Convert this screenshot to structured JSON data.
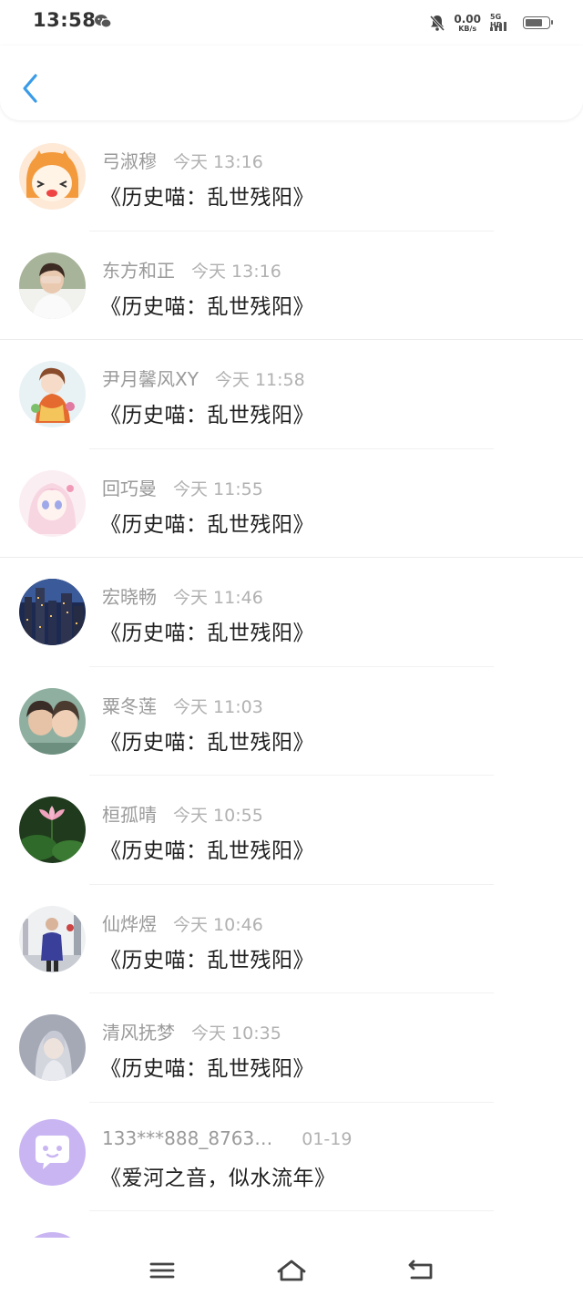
{
  "status_bar": {
    "time": "13:58",
    "net_speed_value": "0.00",
    "net_speed_unit": "KB/s",
    "signal_label": "5G HD",
    "battery_level_percent": 80
  },
  "header": {
    "back_icon": "chevron-left-icon",
    "accent": "#3a9be8"
  },
  "items": [
    {
      "name": "弓淑穆",
      "time": "今天 13:16",
      "title": "《历史喵：乱世残阳》"
    },
    {
      "name": "东方和正",
      "time": "今天 13:16",
      "title": "《历史喵：乱世残阳》"
    },
    {
      "name": "尹月馨风XY",
      "time": "今天 11:58",
      "title": "《历史喵：乱世残阳》"
    },
    {
      "name": "回巧曼",
      "time": "今天 11:55",
      "title": "《历史喵：乱世残阳》"
    },
    {
      "name": "宏晓畅",
      "time": "今天 11:46",
      "title": "《历史喵：乱世残阳》"
    },
    {
      "name": "粟冬莲",
      "time": "今天 11:03",
      "title": "《历史喵：乱世残阳》"
    },
    {
      "name": "桓孤晴",
      "time": "今天 10:55",
      "title": "《历史喵：乱世残阳》"
    },
    {
      "name": "仙烨煜",
      "time": "今天 10:46",
      "title": "《历史喵：乱世残阳》"
    },
    {
      "name": "清风抚梦",
      "time": "今天 10:35",
      "title": "《历史喵：乱世残阳》"
    },
    {
      "name": "133***888_8763…",
      "time": "01-19",
      "title": "《爱河之音，似水流年》"
    }
  ],
  "navbar": {
    "menu_icon": "menu-icon",
    "home_icon": "home-icon",
    "back_icon": "return-icon"
  }
}
